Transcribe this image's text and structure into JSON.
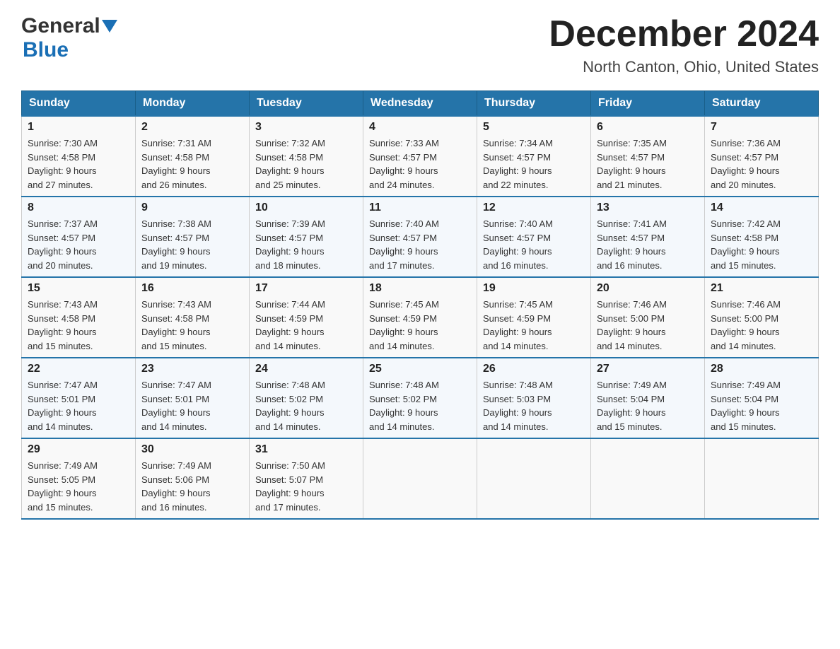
{
  "header": {
    "logo_text": "General",
    "logo_blue": "Blue",
    "title": "December 2024",
    "subtitle": "North Canton, Ohio, United States"
  },
  "days_of_week": [
    "Sunday",
    "Monday",
    "Tuesday",
    "Wednesday",
    "Thursday",
    "Friday",
    "Saturday"
  ],
  "weeks": [
    [
      {
        "day": "1",
        "sunrise": "7:30 AM",
        "sunset": "4:58 PM",
        "daylight": "9 hours and 27 minutes."
      },
      {
        "day": "2",
        "sunrise": "7:31 AM",
        "sunset": "4:58 PM",
        "daylight": "9 hours and 26 minutes."
      },
      {
        "day": "3",
        "sunrise": "7:32 AM",
        "sunset": "4:58 PM",
        "daylight": "9 hours and 25 minutes."
      },
      {
        "day": "4",
        "sunrise": "7:33 AM",
        "sunset": "4:57 PM",
        "daylight": "9 hours and 24 minutes."
      },
      {
        "day": "5",
        "sunrise": "7:34 AM",
        "sunset": "4:57 PM",
        "daylight": "9 hours and 22 minutes."
      },
      {
        "day": "6",
        "sunrise": "7:35 AM",
        "sunset": "4:57 PM",
        "daylight": "9 hours and 21 minutes."
      },
      {
        "day": "7",
        "sunrise": "7:36 AM",
        "sunset": "4:57 PM",
        "daylight": "9 hours and 20 minutes."
      }
    ],
    [
      {
        "day": "8",
        "sunrise": "7:37 AM",
        "sunset": "4:57 PM",
        "daylight": "9 hours and 20 minutes."
      },
      {
        "day": "9",
        "sunrise": "7:38 AM",
        "sunset": "4:57 PM",
        "daylight": "9 hours and 19 minutes."
      },
      {
        "day": "10",
        "sunrise": "7:39 AM",
        "sunset": "4:57 PM",
        "daylight": "9 hours and 18 minutes."
      },
      {
        "day": "11",
        "sunrise": "7:40 AM",
        "sunset": "4:57 PM",
        "daylight": "9 hours and 17 minutes."
      },
      {
        "day": "12",
        "sunrise": "7:40 AM",
        "sunset": "4:57 PM",
        "daylight": "9 hours and 16 minutes."
      },
      {
        "day": "13",
        "sunrise": "7:41 AM",
        "sunset": "4:57 PM",
        "daylight": "9 hours and 16 minutes."
      },
      {
        "day": "14",
        "sunrise": "7:42 AM",
        "sunset": "4:58 PM",
        "daylight": "9 hours and 15 minutes."
      }
    ],
    [
      {
        "day": "15",
        "sunrise": "7:43 AM",
        "sunset": "4:58 PM",
        "daylight": "9 hours and 15 minutes."
      },
      {
        "day": "16",
        "sunrise": "7:43 AM",
        "sunset": "4:58 PM",
        "daylight": "9 hours and 15 minutes."
      },
      {
        "day": "17",
        "sunrise": "7:44 AM",
        "sunset": "4:59 PM",
        "daylight": "9 hours and 14 minutes."
      },
      {
        "day": "18",
        "sunrise": "7:45 AM",
        "sunset": "4:59 PM",
        "daylight": "9 hours and 14 minutes."
      },
      {
        "day": "19",
        "sunrise": "7:45 AM",
        "sunset": "4:59 PM",
        "daylight": "9 hours and 14 minutes."
      },
      {
        "day": "20",
        "sunrise": "7:46 AM",
        "sunset": "5:00 PM",
        "daylight": "9 hours and 14 minutes."
      },
      {
        "day": "21",
        "sunrise": "7:46 AM",
        "sunset": "5:00 PM",
        "daylight": "9 hours and 14 minutes."
      }
    ],
    [
      {
        "day": "22",
        "sunrise": "7:47 AM",
        "sunset": "5:01 PM",
        "daylight": "9 hours and 14 minutes."
      },
      {
        "day": "23",
        "sunrise": "7:47 AM",
        "sunset": "5:01 PM",
        "daylight": "9 hours and 14 minutes."
      },
      {
        "day": "24",
        "sunrise": "7:48 AM",
        "sunset": "5:02 PM",
        "daylight": "9 hours and 14 minutes."
      },
      {
        "day": "25",
        "sunrise": "7:48 AM",
        "sunset": "5:02 PM",
        "daylight": "9 hours and 14 minutes."
      },
      {
        "day": "26",
        "sunrise": "7:48 AM",
        "sunset": "5:03 PM",
        "daylight": "9 hours and 14 minutes."
      },
      {
        "day": "27",
        "sunrise": "7:49 AM",
        "sunset": "5:04 PM",
        "daylight": "9 hours and 15 minutes."
      },
      {
        "day": "28",
        "sunrise": "7:49 AM",
        "sunset": "5:04 PM",
        "daylight": "9 hours and 15 minutes."
      }
    ],
    [
      {
        "day": "29",
        "sunrise": "7:49 AM",
        "sunset": "5:05 PM",
        "daylight": "9 hours and 15 minutes."
      },
      {
        "day": "30",
        "sunrise": "7:49 AM",
        "sunset": "5:06 PM",
        "daylight": "9 hours and 16 minutes."
      },
      {
        "day": "31",
        "sunrise": "7:50 AM",
        "sunset": "5:07 PM",
        "daylight": "9 hours and 17 minutes."
      },
      null,
      null,
      null,
      null
    ]
  ],
  "labels": {
    "sunrise": "Sunrise:",
    "sunset": "Sunset:",
    "daylight": "Daylight:"
  }
}
